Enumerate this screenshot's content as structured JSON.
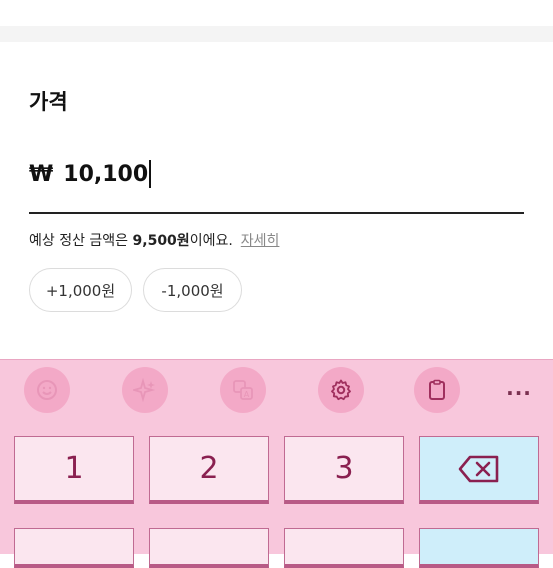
{
  "form": {
    "price_label": "가격",
    "currency_symbol": "₩",
    "price_value": "10,100",
    "settlement_prefix": "예상 정산 금액은 ",
    "settlement_amount": "9,500원",
    "settlement_suffix": "이에요.",
    "details_link": "자세히"
  },
  "chips": [
    "+1,000원",
    "-1,000원"
  ],
  "keyboard": {
    "toolbar": [
      "emoji-icon",
      "sparkle-icon",
      "translate-icon",
      "settings-gear-icon",
      "clipboard-icon",
      "more-icon"
    ],
    "more_label": "...",
    "keys": [
      "1",
      "2",
      "3"
    ],
    "colors": {
      "background": "#f8c7dc",
      "key": "#fbe6ef",
      "key_special": "#cfeefa",
      "accent": "#b0306a"
    }
  }
}
